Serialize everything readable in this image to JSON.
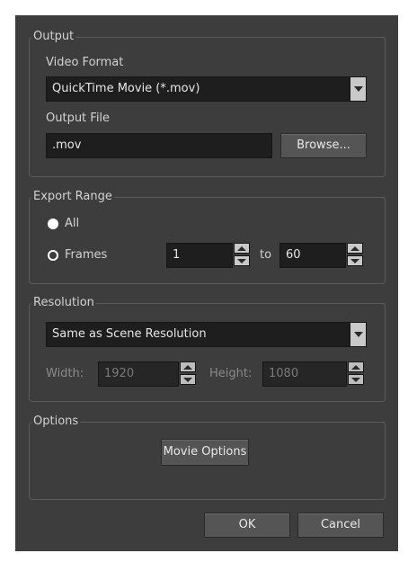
{
  "output": {
    "title": "Output",
    "video_format_label": "Video Format",
    "video_format_value": "QuickTime Movie (*.mov)",
    "output_file_label": "Output File",
    "output_file_value": ".mov",
    "browse_label": "Browse..."
  },
  "export_range": {
    "title": "Export Range",
    "all_label": "All",
    "frames_label": "Frames",
    "selected": "All",
    "from_value": "1",
    "to_label": "to",
    "to_value": "60"
  },
  "resolution": {
    "title": "Resolution",
    "preset_value": "Same as Scene Resolution",
    "width_label": "Width:",
    "width_value": "1920",
    "height_label": "Height:",
    "height_value": "1080"
  },
  "options": {
    "title": "Options",
    "movie_options_label": "Movie Options"
  },
  "footer": {
    "ok_label": "OK",
    "cancel_label": "Cancel"
  },
  "colors": {
    "dialog_bg": "#3d3d3d",
    "field_bg": "#1e1e1e",
    "button_bg": "#555555"
  }
}
